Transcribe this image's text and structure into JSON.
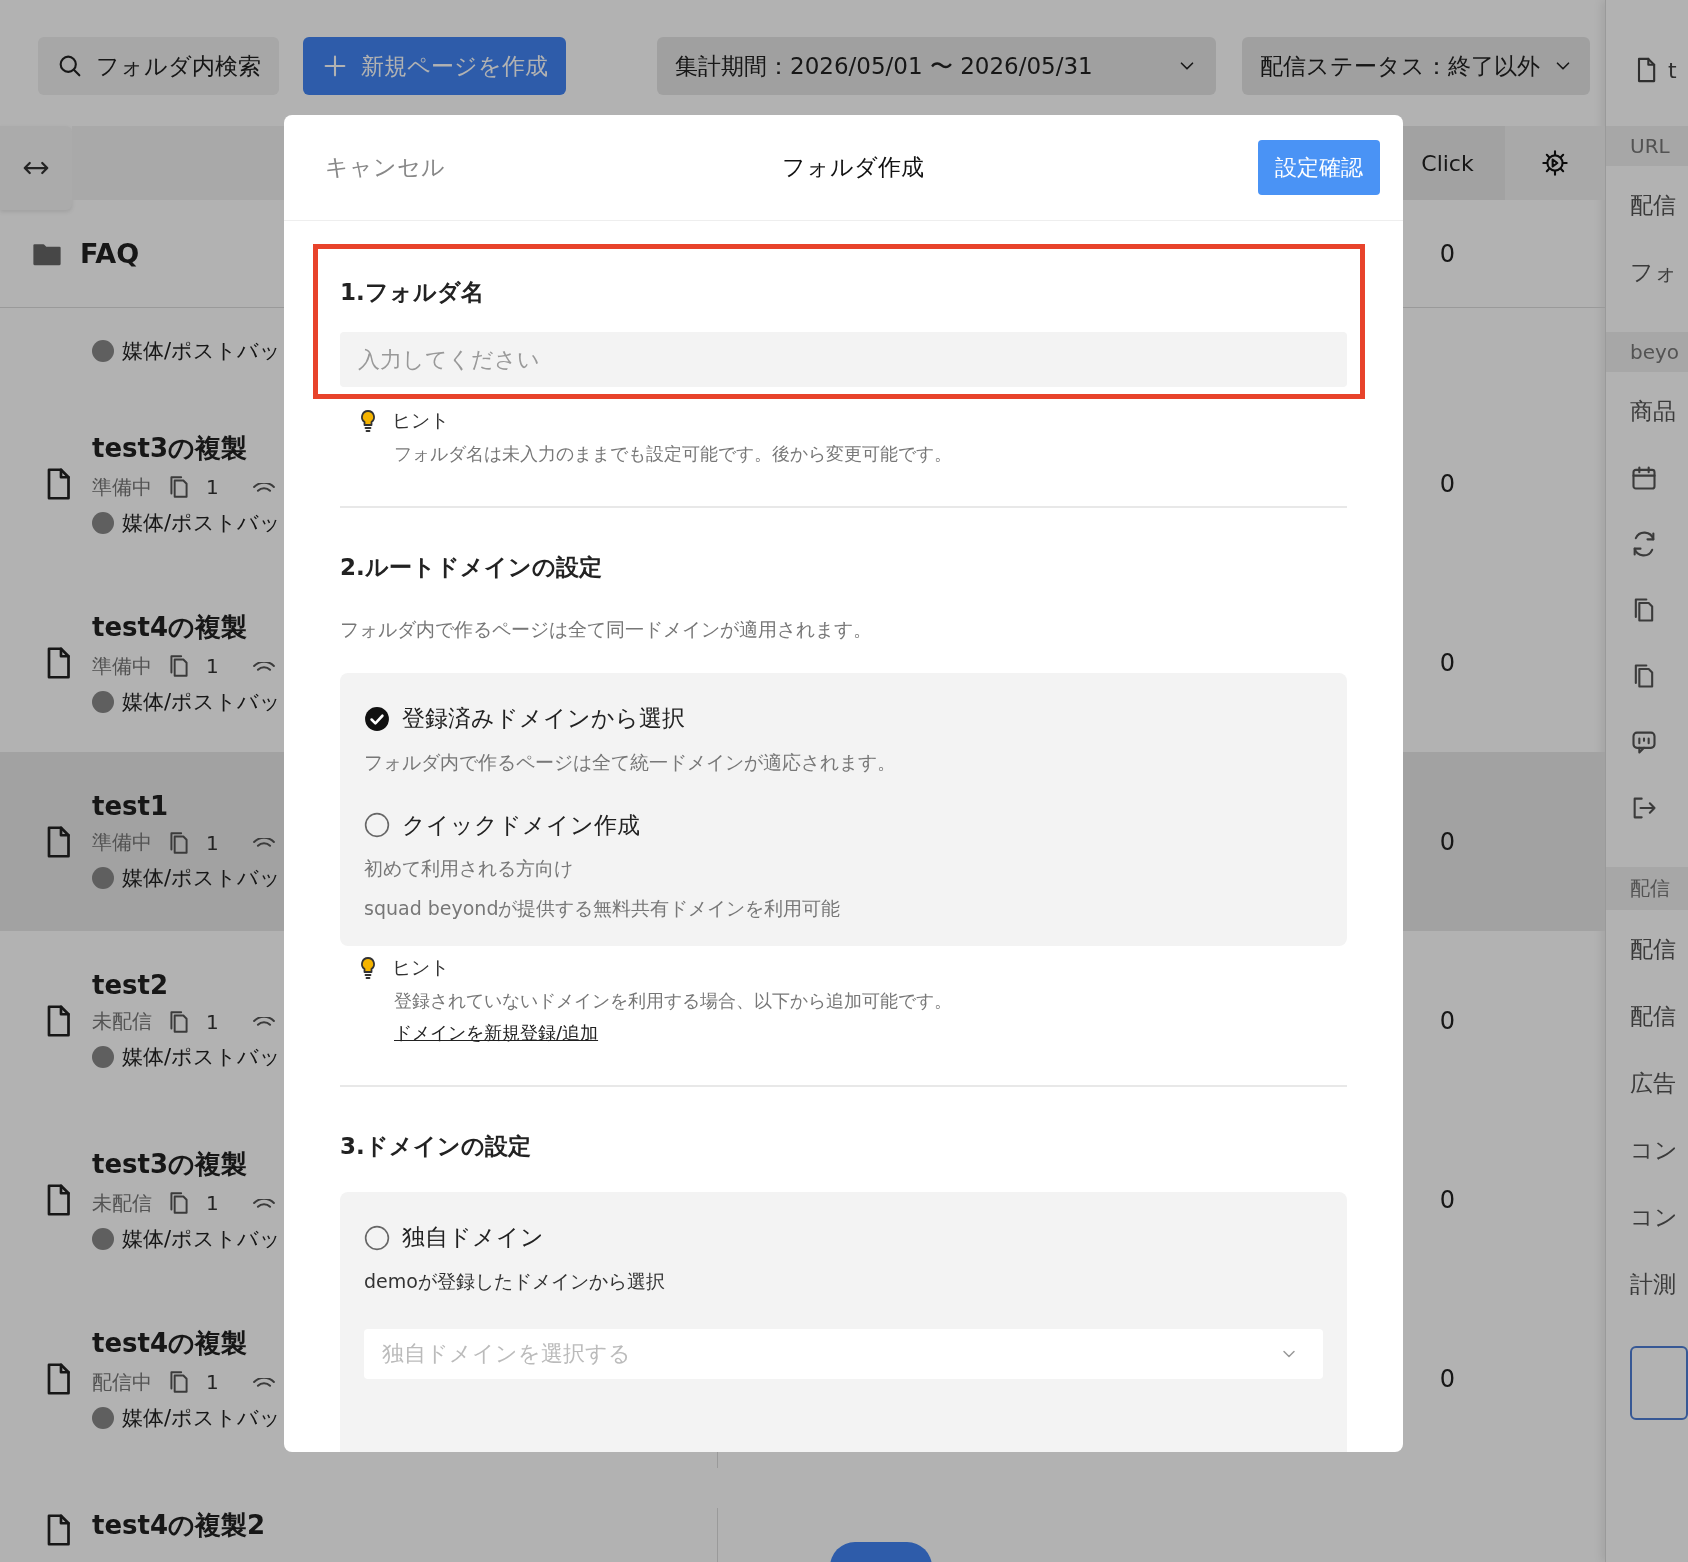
{
  "toolbar": {
    "search": "フォルダ内検索",
    "new_page": "新規ページを作成",
    "period": "集計期間：2026/05/01 〜 2026/05/31",
    "status_filter": "配信ステータス：終了以外"
  },
  "table_header": {
    "click": "Click"
  },
  "folder": {
    "name": "FAQ",
    "click": "0"
  },
  "pages": [
    {
      "kind": "partial",
      "media": "媒体/ポストバッ",
      "selected": false
    },
    {
      "kind": "page",
      "title": "test3の複製",
      "status": "準備中",
      "copies": "1",
      "media": "媒体/ポストバッ",
      "click": "0",
      "selected": false
    },
    {
      "kind": "page",
      "title": "test4の複製",
      "status": "準備中",
      "copies": "1",
      "media": "媒体/ポストバッ",
      "click": "0",
      "selected": false
    },
    {
      "kind": "page",
      "title": "test1",
      "status": "準備中",
      "copies": "1",
      "media": "媒体/ポストバッ",
      "click": "0",
      "selected": true
    },
    {
      "kind": "page",
      "title": "test2",
      "status": "未配信",
      "copies": "1",
      "media": "媒体/ポストバッ",
      "click": "0",
      "selected": false
    },
    {
      "kind": "page",
      "title": "test3の複製",
      "status": "未配信",
      "copies": "1",
      "media": "媒体/ポストバッ",
      "click": "0",
      "selected": false
    },
    {
      "kind": "page",
      "title": "test4の複製",
      "status": "配信中",
      "copies": "1",
      "media": "媒体/ポストバッ",
      "click": "0",
      "selected": false
    },
    {
      "kind": "title_only",
      "title": "test4の複製2",
      "selected": false
    }
  ],
  "side_panel": {
    "top_label": "t",
    "items": [
      {
        "kind": "header",
        "text": "URL"
      },
      {
        "kind": "text",
        "text": "配信"
      },
      {
        "kind": "text",
        "text": "フォ"
      },
      {
        "kind": "header",
        "text": "beyo"
      },
      {
        "kind": "text",
        "text": "商品"
      },
      {
        "kind": "icons"
      },
      {
        "kind": "header",
        "text": "配信"
      },
      {
        "kind": "text",
        "text": "配信"
      },
      {
        "kind": "text",
        "text": "配信"
      },
      {
        "kind": "text",
        "text": "広告"
      },
      {
        "kind": "text",
        "text": "コン"
      },
      {
        "kind": "text",
        "text": "コン"
      },
      {
        "kind": "text",
        "text": "計測"
      },
      {
        "kind": "button"
      }
    ]
  },
  "modal": {
    "cancel": "キャンセル",
    "title": "フォルダ作成",
    "confirm": "設定確認",
    "name_section": {
      "heading": "1.フォルダ名",
      "highlighted": true,
      "placeholder": "入力してください",
      "hint": {
        "label": "ヒント",
        "text": "フォルダ名は未入力のままでも設定可能です。後から変更可能です。"
      }
    },
    "root_domain_section": {
      "heading": "2.ルートドメインの設定",
      "description": "フォルダ内で作るページは全て同一ドメインが適用されます。",
      "options": [
        {
          "label": "登録済みドメインから選択",
          "description": [
            "フォルダ内で作るページは全て統一ドメインが適応されます。"
          ],
          "selected": true
        },
        {
          "label": "クイックドメイン作成",
          "description": [
            "初めて利用される方向け",
            "squad beyondが提供する無料共有ドメインを利用可能"
          ],
          "selected": false
        }
      ],
      "hint": {
        "label": "ヒント",
        "text": "登録されていないドメインを利用する場合、以下から追加可能です。",
        "link": "ドメインを新規登録/追加"
      }
    },
    "domain_section": {
      "heading": "3.ドメインの設定",
      "options": [
        {
          "label": "独自ドメイン",
          "description": [
            "demoが登録したドメインから選択"
          ],
          "selected": false
        }
      ],
      "select_placeholder": "独自ドメインを選択する"
    }
  }
}
